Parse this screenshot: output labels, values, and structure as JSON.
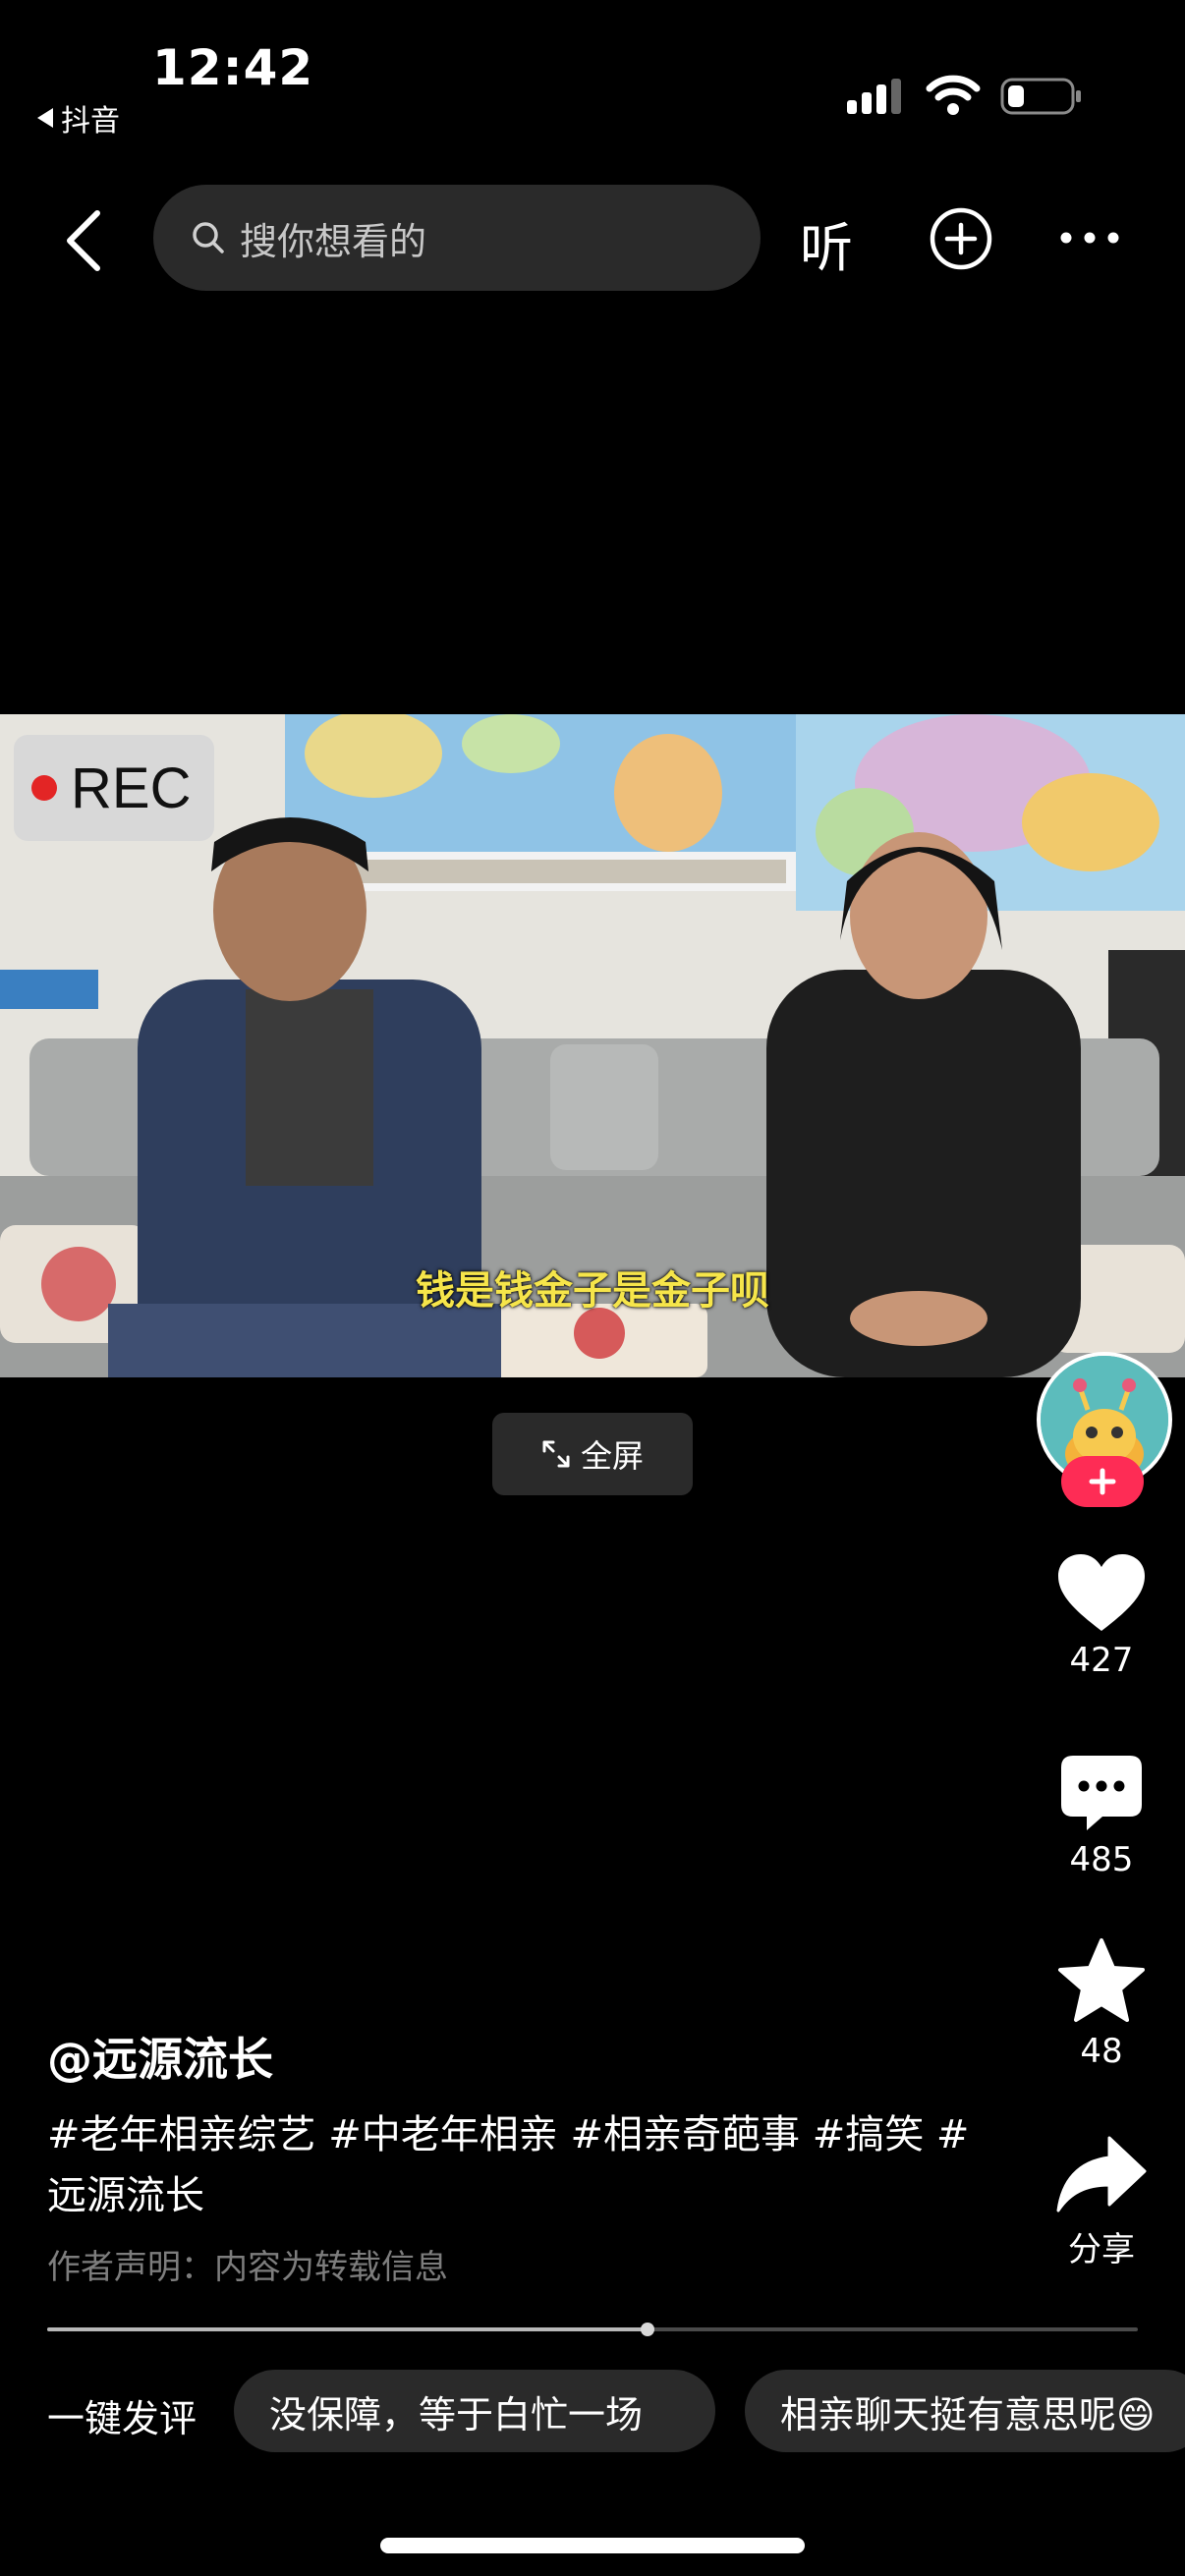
{
  "status_bar": {
    "time": "12:42",
    "back_app": "抖音"
  },
  "nav": {
    "search_placeholder": "搜你想看的",
    "listen_label": "听"
  },
  "video": {
    "rec_label": "REC",
    "subtitle": "钱是钱金子是金子呗",
    "fullscreen_label": "全屏",
    "progress": 0.55
  },
  "rail": {
    "likes": "427",
    "comments": "485",
    "favorites": "48",
    "share_label": "分享"
  },
  "caption": {
    "author": "@远源流长",
    "hashtags": "#老年相亲综艺 #中老年相亲 #相亲奇葩事  #搞笑 #远源流长",
    "disclaimer": "作者声明：内容为转载信息"
  },
  "quick_comments": {
    "label": "一键发评",
    "chips": [
      "没保障，等于白忙一场",
      "相亲聊天挺有意思呢😄"
    ]
  }
}
